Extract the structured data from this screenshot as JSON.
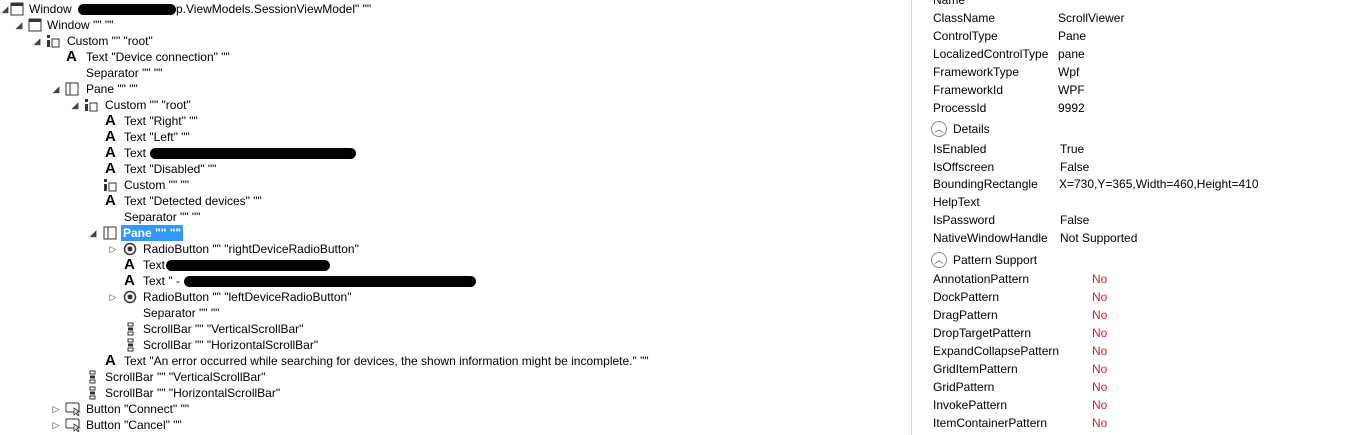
{
  "tree": {
    "window_root_prefix": "Window",
    "window_root_suffix": "p.ViewModels.SessionViewModel\" \"\"",
    "window": "Window \"\" \"\"",
    "custom_root": "Custom \"\" \"root\"",
    "text_device_connection": "Text \"Device connection\" \"\"",
    "separator": "Separator \"\" \"\"",
    "pane": "Pane \"\" \"\"",
    "custom_root_2": "Custom \"\" \"root\"",
    "text_right": "Text \"Right\" \"\"",
    "text_left": "Text \"Left\" \"\"",
    "text_redacted": "Text",
    "text_disabled": "Text \"Disabled\" \"\"",
    "custom_empty": "Custom \"\" \"\"",
    "text_detected_devices": "Text \"Detected devices\" \"\"",
    "separator_2": "Separator \"\" \"\"",
    "pane_selected": "Pane \"\" \"\"",
    "radio_right": "RadioButton \"\" \"rightDeviceRadioButton\"",
    "text_redacted_2": "Text",
    "text_redacted_3": "Text \" -",
    "radio_left": "RadioButton \"\" \"leftDeviceRadioButton\"",
    "separator_3": "Separator \"\" \"\"",
    "vscroll_inner": "ScrollBar \"\" \"VerticalScrollBar\"",
    "hscroll_inner": "ScrollBar \"\" \"HorizontalScrollBar\"",
    "text_error": "Text \"An error occurred while searching for devices, the shown information might be incomplete.\" \"\"",
    "vscroll_outer": "ScrollBar \"\" \"VerticalScrollBar\"",
    "hscroll_outer": "ScrollBar \"\" \"HorizontalScrollBar\"",
    "button_connect": "Button \"Connect\" \"\"",
    "button_cancel": "Button \"Cancel\" \"\""
  },
  "properties": {
    "name_label": "Name",
    "classname": {
      "name": "ClassName",
      "value": "ScrollViewer"
    },
    "controltype": {
      "name": "ControlType",
      "value": "Pane"
    },
    "localizedcontroltype": {
      "name": "LocalizedControlType",
      "value": "pane"
    },
    "frameworktype": {
      "name": "FrameworkType",
      "value": "Wpf"
    },
    "frameworkid": {
      "name": "FrameworkId",
      "value": "WPF"
    },
    "processid": {
      "name": "ProcessId",
      "value": "9992"
    },
    "details_header": "Details",
    "isenabled": {
      "name": "IsEnabled",
      "value": "True"
    },
    "isoffscreen": {
      "name": "IsOffscreen",
      "value": "False"
    },
    "boundingrectangle": {
      "name": "BoundingRectangle",
      "value": "X=730,Y=365,Width=460,Height=410"
    },
    "helptext": {
      "name": "HelpText",
      "value": ""
    },
    "ispassword": {
      "name": "IsPassword",
      "value": "False"
    },
    "nativewindowhandle": {
      "name": "NativeWindowHandle",
      "value": "Not Supported"
    },
    "pattern_header": "Pattern Support",
    "patterns": [
      {
        "name": "AnnotationPattern",
        "value": "No"
      },
      {
        "name": "DockPattern",
        "value": "No"
      },
      {
        "name": "DragPattern",
        "value": "No"
      },
      {
        "name": "DropTargetPattern",
        "value": "No"
      },
      {
        "name": "ExpandCollapsePattern",
        "value": "No"
      },
      {
        "name": "GridItemPattern",
        "value": "No"
      },
      {
        "name": "GridPattern",
        "value": "No"
      },
      {
        "name": "InvokePattern",
        "value": "No"
      },
      {
        "name": "ItemContainerPattern",
        "value": "No"
      }
    ],
    "no_color": "#e02020"
  },
  "colors": {
    "selection": "#3399ff"
  }
}
